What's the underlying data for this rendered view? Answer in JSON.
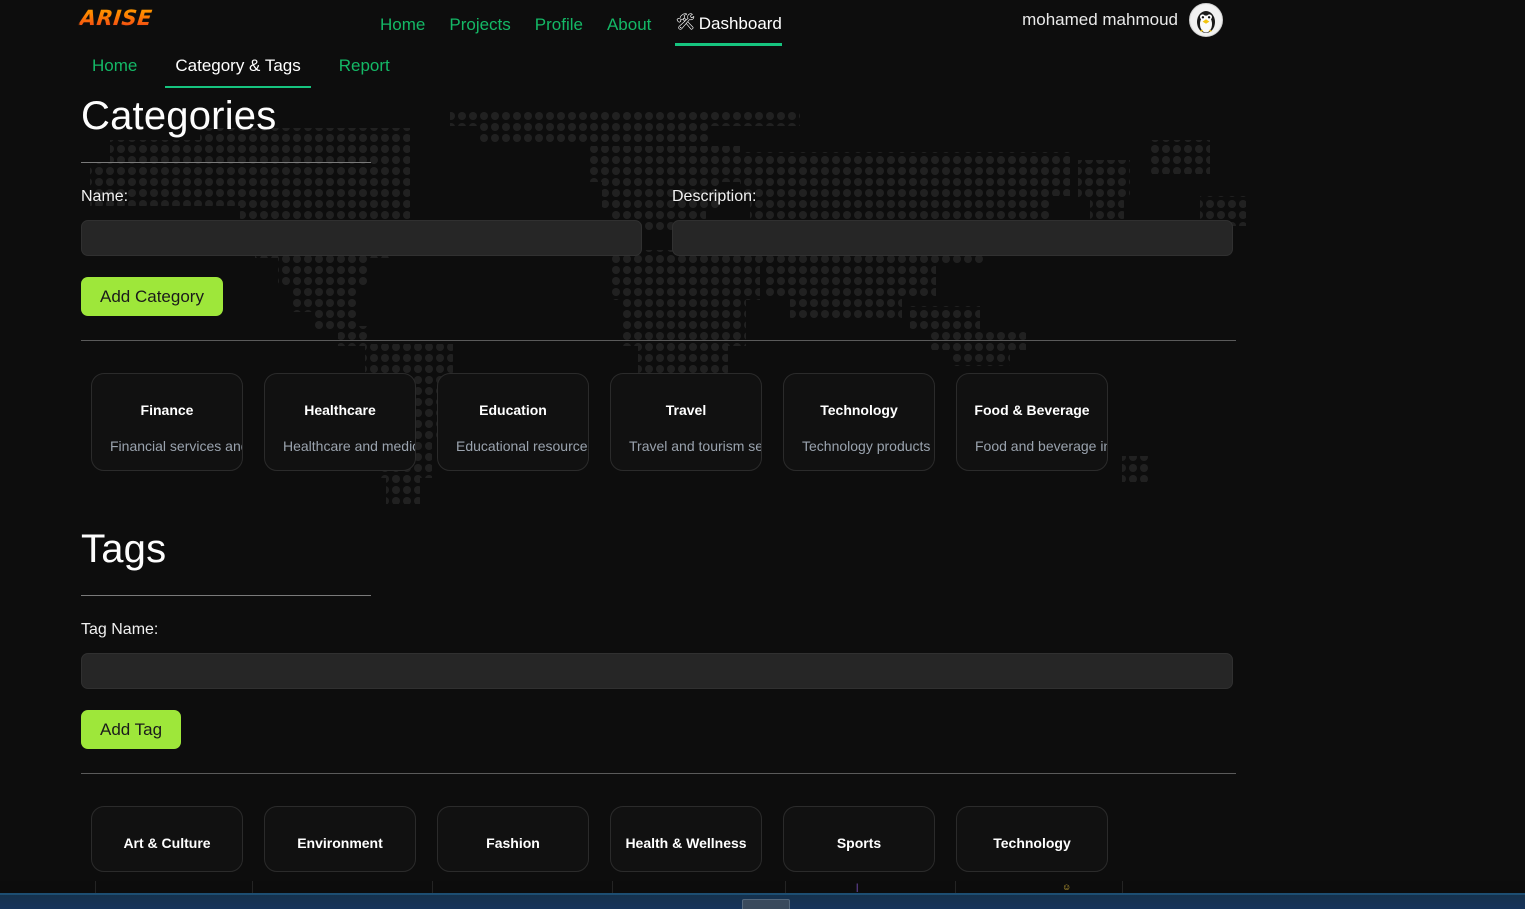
{
  "brand": {
    "name": "ARISE"
  },
  "topnav": {
    "links": [
      {
        "label": "Home",
        "active": false
      },
      {
        "label": "Projects",
        "active": false
      },
      {
        "label": "Profile",
        "active": false
      },
      {
        "label": "About",
        "active": false
      },
      {
        "label": "Dashboard",
        "active": true,
        "icon": "tools-icon",
        "glyph": "🛠"
      }
    ]
  },
  "user": {
    "name": "mohamed mahmoud",
    "avatar_icon": "penguin-avatar"
  },
  "subtabs": [
    {
      "label": "Home",
      "active": false
    },
    {
      "label": "Category & Tags",
      "active": true
    },
    {
      "label": "Report",
      "active": false
    }
  ],
  "categories_section": {
    "title": "Categories",
    "name_label": "Name:",
    "name_value": "",
    "name_placeholder": "",
    "description_label": "Description:",
    "description_value": "",
    "description_placeholder": "",
    "add_button": "Add Category",
    "cards": [
      {
        "title": "Finance",
        "description": "Financial services and p"
      },
      {
        "title": "Healthcare",
        "description": "Healthcare and medica"
      },
      {
        "title": "Education",
        "description": "Educational resources a"
      },
      {
        "title": "Travel",
        "description": "Travel and tourism serv"
      },
      {
        "title": "Technology",
        "description": "Technology products a"
      },
      {
        "title": "Food & Beverage",
        "description": "Food and beverage ind"
      }
    ]
  },
  "tags_section": {
    "title": "Tags",
    "name_label": "Tag Name:",
    "name_value": "",
    "name_placeholder": "",
    "add_button": "Add Tag",
    "cards": [
      {
        "title": "Art & Culture"
      },
      {
        "title": "Environment"
      },
      {
        "title": "Fashion"
      },
      {
        "title": "Health & Wellness"
      },
      {
        "title": "Sports"
      },
      {
        "title": "Technology"
      }
    ]
  },
  "colors": {
    "page_background": "#0d0d0d",
    "nav_link": "#14b866",
    "nav_active_underline": "#16c47f",
    "accent_button": "#9ee73a",
    "card_background": "#111111",
    "card_border": "#2b2b2b",
    "input_background": "#262626",
    "text_primary": "#ffffff",
    "text_muted": "#9aa3ae",
    "brand_gradient_start": "#ffb300",
    "brand_gradient_end": "#ef3c1b",
    "taskbar": "#16335a"
  }
}
